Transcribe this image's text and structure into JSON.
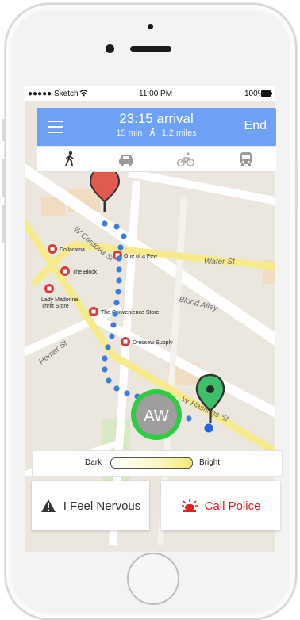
{
  "status_bar": {
    "carrier": "●●●●● Sketch",
    "time": "11:00 PM",
    "battery": "100%"
  },
  "header": {
    "arrival": "23:15 arrival",
    "duration": "15 min",
    "distance": "1.2 miles",
    "end_label": "End"
  },
  "transport_modes": [
    "walk",
    "car",
    "bike",
    "bus"
  ],
  "selected_mode": "walk",
  "map": {
    "streets": [
      "W Cordova St",
      "Water St",
      "Blood Alley",
      "Homer St",
      "W Hastings St"
    ],
    "pois": [
      "Dollarama",
      "One of a Few",
      "The Block",
      "Lady Madonna",
      "Thrift Store",
      "The Convenience Store",
      "Dressew Supply"
    ],
    "avatar_initials": "AW"
  },
  "brightness": {
    "dark_label": "Dark",
    "bright_label": "Bright"
  },
  "actions": {
    "nervous_label": "I Feel Nervous",
    "police_label": "Call Police"
  },
  "colors": {
    "header_blue": "#6ea1f5",
    "route_dot": "#3b7ddd",
    "avatar_ring": "#2ecc40",
    "destination_pin": "#3fbf6a",
    "start_pin": "#e05a4f",
    "police_red": "#e02020"
  }
}
